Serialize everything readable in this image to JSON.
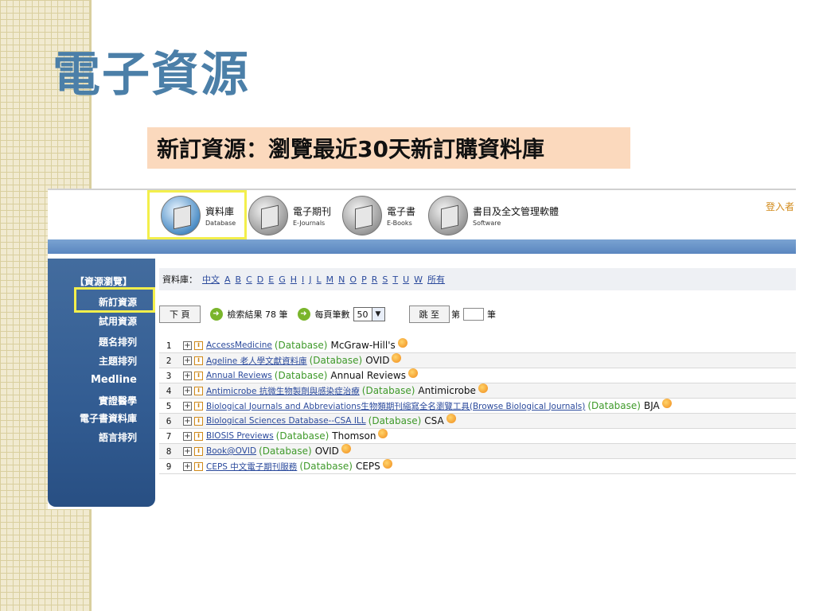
{
  "slide": {
    "title": "電子資源",
    "subtitle": "新訂資源：瀏覽最近30天新訂購資料庫"
  },
  "nav": {
    "items": [
      {
        "zh": "資料庫",
        "en": "Database",
        "icon": "database-icon"
      },
      {
        "zh": "電子期刊",
        "en": "E-Journals",
        "icon": "journal-icon"
      },
      {
        "zh": "電子書",
        "en": "E-Books",
        "icon": "ebook-icon"
      },
      {
        "zh": "書目及全文管理軟體",
        "en": "Software",
        "icon": "software-icon"
      }
    ],
    "login": "登入者"
  },
  "sidebar": {
    "header": "【資源瀏覽】",
    "items": [
      "新訂資源",
      "試用資源",
      "題名排列",
      "主題排列",
      "Medline",
      "實證醫學",
      "電子書資料庫",
      "語言排列"
    ]
  },
  "browse": {
    "label": "資料庫：",
    "letters": [
      "中文",
      "A",
      "B",
      "C",
      "D",
      "E",
      "G",
      "H",
      "I",
      "J",
      "L",
      "M",
      "N",
      "O",
      "P",
      "R",
      "S",
      "T",
      "U",
      "W",
      "所有"
    ]
  },
  "controls": {
    "next_label": "下 頁",
    "result_text": "檢索結果 78 筆",
    "per_page_label": "每頁筆數",
    "per_page_value": "50",
    "jump_label": "跳 至",
    "jump_prefix": "第",
    "jump_suffix": "筆"
  },
  "rows": [
    {
      "num": "1",
      "name": "AccessMedicine",
      "type": "(Database)",
      "vendor": "McGraw-Hill's"
    },
    {
      "num": "2",
      "name": "Ageline 老人學文獻資料庫",
      "type": "(Database)",
      "vendor": "OVID"
    },
    {
      "num": "3",
      "name": "Annual Reviews",
      "type": "(Database)",
      "vendor": "Annual Reviews"
    },
    {
      "num": "4",
      "name": "Antimicrobe 抗微生物製劑與感染症治療",
      "type": "(Database)",
      "vendor": "Antimicrobe"
    },
    {
      "num": "5",
      "name": "Biological Journals and Abbreviations生物類期刊縮寫全名瀏覽工具(Browse Biological Journals)",
      "type": "(Database)",
      "vendor": "BJA"
    },
    {
      "num": "6",
      "name": "Biological Sciences Database--CSA ILL",
      "type": "(Database)",
      "vendor": "CSA"
    },
    {
      "num": "7",
      "name": "BIOSIS Previews",
      "type": "(Database)",
      "vendor": "Thomson"
    },
    {
      "num": "8",
      "name": "Book@OVID",
      "type": "(Database)",
      "vendor": "OVID"
    },
    {
      "num": "9",
      "name": "CEPS 中文電子期刊服務",
      "type": "(Database)",
      "vendor": "CEPS"
    }
  ],
  "colors": {
    "title": "#4b7fa8",
    "subtitle_bg": "#fbd9bd",
    "sidebar": "#325c92",
    "highlight": "#f3ef4b",
    "link": "#2b4a9c",
    "type_green": "#3f9a2a"
  }
}
